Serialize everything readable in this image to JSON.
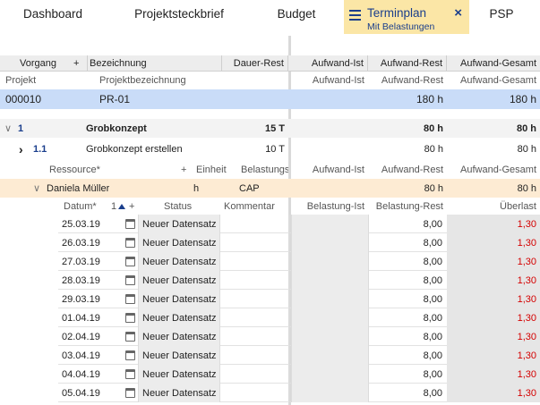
{
  "nav": {
    "tabs": [
      "Dashboard",
      "Projektsteckbrief",
      "Budget"
    ],
    "active_title": "Terminplan",
    "active_subtitle": "Mit Belastungen",
    "last_tab": "PSP"
  },
  "header": {
    "vorgang": "Vorgang",
    "plus": "+",
    "bezeichnung": "Bezeichnung",
    "dauer_rest": "Dauer-Rest",
    "aufwand_ist": "Aufwand-Ist",
    "aufwand_rest": "Aufwand-Rest",
    "aufwand_gesamt": "Aufwand-Gesamt"
  },
  "project_header": {
    "projekt": "Projekt",
    "projektbezeichnung": "Projektbezeichnung",
    "aufwand_ist": "Aufwand-Ist",
    "aufwand_rest": "Aufwand-Rest",
    "aufwand_gesamt": "Aufwand-Gesamt"
  },
  "project_row": {
    "id": "000010",
    "name": "PR-01",
    "rest": "180 h",
    "gesamt": "180 h"
  },
  "group_row": {
    "toggle": "∨",
    "id": "1",
    "name": "Grobkonzept",
    "dauer": "15 T",
    "rest": "80 h",
    "gesamt": "80 h"
  },
  "task_row": {
    "toggle": "›",
    "id": "1.1",
    "name": "Grobkonzept erstellen",
    "dauer": "10 T",
    "rest": "80 h",
    "gesamt": "80 h"
  },
  "resource_header": {
    "ressource": "Ressource*",
    "plus": "+",
    "einheit": "Einheit",
    "belastung": "Belastungs",
    "aufwand_ist": "Aufwand-Ist",
    "aufwand_rest": "Aufwand-Rest",
    "aufwand_gesamt": "Aufwand-Gesamt"
  },
  "resource_row": {
    "toggle": "∨",
    "name": "Daniela Müller",
    "einheit": "h",
    "belastung": "CAP",
    "rest": "80 h",
    "gesamt": "80 h"
  },
  "load_header": {
    "datum": "Datum*",
    "sort_index": "1",
    "plus": "+",
    "status": "Status",
    "kommentar": "Kommentar",
    "belastung_ist": "Belastung-Ist",
    "belastung_rest": "Belastung-Rest",
    "ueberlast": "Überlast"
  },
  "load_rows": [
    {
      "datum": "25.03.19",
      "status": "Neuer Datensatz",
      "rest": "8,00",
      "ueberlast": "1,30"
    },
    {
      "datum": "26.03.19",
      "status": "Neuer Datensatz",
      "rest": "8,00",
      "ueberlast": "1,30"
    },
    {
      "datum": "27.03.19",
      "status": "Neuer Datensatz",
      "rest": "8,00",
      "ueberlast": "1,30"
    },
    {
      "datum": "28.03.19",
      "status": "Neuer Datensatz",
      "rest": "8,00",
      "ueberlast": "1,30"
    },
    {
      "datum": "29.03.19",
      "status": "Neuer Datensatz",
      "rest": "8,00",
      "ueberlast": "1,30"
    },
    {
      "datum": "01.04.19",
      "status": "Neuer Datensatz",
      "rest": "8,00",
      "ueberlast": "1,30"
    },
    {
      "datum": "02.04.19",
      "status": "Neuer Datensatz",
      "rest": "8,00",
      "ueberlast": "1,30"
    },
    {
      "datum": "03.04.19",
      "status": "Neuer Datensatz",
      "rest": "8,00",
      "ueberlast": "1,30"
    },
    {
      "datum": "04.04.19",
      "status": "Neuer Datensatz",
      "rest": "8,00",
      "ueberlast": "1,30"
    },
    {
      "datum": "05.04.19",
      "status": "Neuer Datensatz",
      "rest": "8,00",
      "ueberlast": "1,30"
    }
  ],
  "colors": {
    "accent": "#1a3e8c",
    "active_tab": "#fbe6a6",
    "highlight": "#c9dcf8",
    "resource": "#fdebd3",
    "overload": "#d40000"
  }
}
